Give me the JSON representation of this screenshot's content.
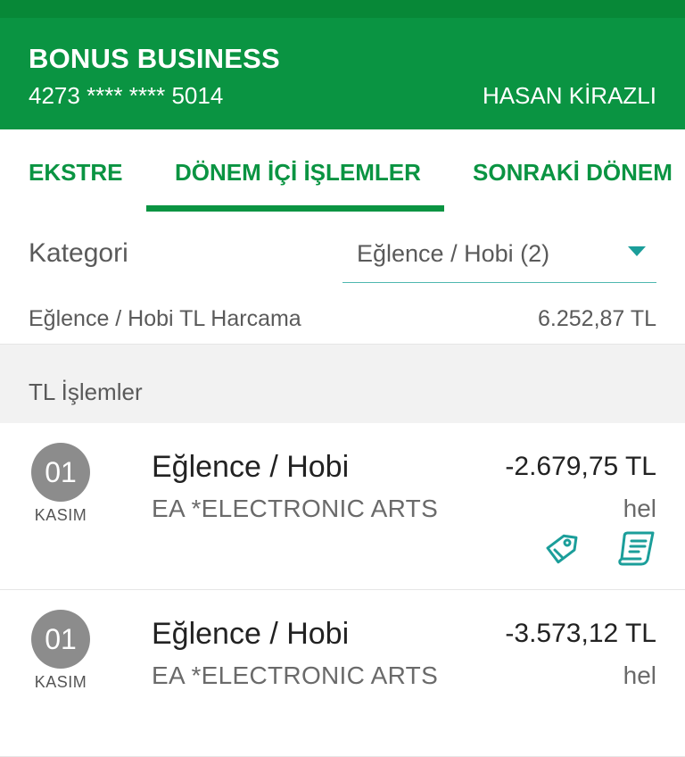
{
  "header": {
    "card_name": "BONUS BUSINESS",
    "card_number": "4273 **** **** 5014",
    "holder": "HASAN KİRAZLI",
    "bg_color": "#0a9442"
  },
  "tabs": [
    {
      "label": "EKSTRE",
      "active": false
    },
    {
      "label": "DÖNEM İÇİ İŞLEMLER",
      "active": true
    },
    {
      "label": "SONRAKİ DÖNEM",
      "active": false
    }
  ],
  "filter": {
    "label": "Kategori",
    "selected": "Eğlence / Hobi (2)"
  },
  "summary": {
    "label": "Eğlence / Hobi TL Harcama",
    "value": "6.252,87 TL"
  },
  "section": {
    "label": "TL İşlemler"
  },
  "transactions": [
    {
      "day": "01",
      "month": "KASIM",
      "category": "Eğlence / Hobi",
      "merchant": "EA *ELECTRONIC ARTS",
      "amount": "-2.679,75 TL",
      "note": "hel",
      "icons": [
        "tag-icon",
        "receipt-icon"
      ]
    },
    {
      "day": "01",
      "month": "KASIM",
      "category": "Eğlence / Hobi",
      "merchant": "EA *ELECTRONIC ARTS",
      "amount": "-3.573,12 TL",
      "note": "hel"
    }
  ],
  "colors": {
    "accent": "#0a9442",
    "teal": "#1b9e9a",
    "badge": "#8c8c8c"
  }
}
